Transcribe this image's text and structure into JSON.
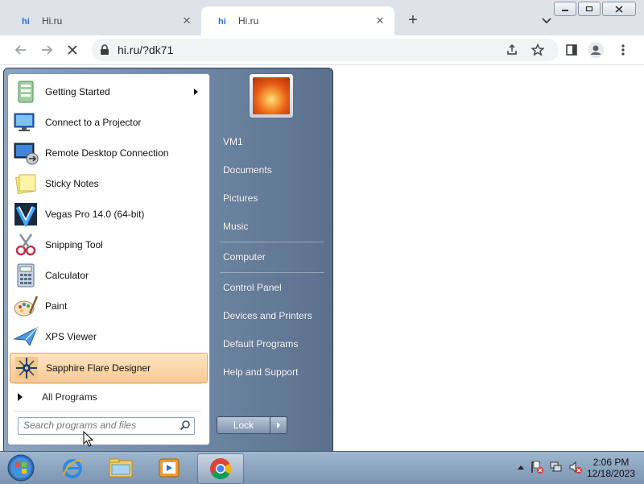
{
  "browser": {
    "tabs": [
      {
        "title": "Hi.ru",
        "active": false
      },
      {
        "title": "Hi.ru",
        "active": true
      }
    ],
    "url": "hi.ru/?dk71",
    "favicon_text": "hi"
  },
  "start_menu": {
    "programs": [
      {
        "label": "Getting Started",
        "icon": "getting-started-icon",
        "has_submenu": true
      },
      {
        "label": "Connect to a Projector",
        "icon": "projector-icon"
      },
      {
        "label": "Remote Desktop Connection",
        "icon": "remote-desktop-icon"
      },
      {
        "label": "Sticky Notes",
        "icon": "sticky-notes-icon"
      },
      {
        "label": "Vegas Pro 14.0 (64-bit)",
        "icon": "vegas-pro-icon"
      },
      {
        "label": "Snipping Tool",
        "icon": "snipping-tool-icon"
      },
      {
        "label": "Calculator",
        "icon": "calculator-icon"
      },
      {
        "label": "Paint",
        "icon": "paint-icon"
      },
      {
        "label": "XPS Viewer",
        "icon": "xps-viewer-icon"
      },
      {
        "label": "Sapphire Flare Designer",
        "icon": "sapphire-flare-icon",
        "highlighted": true
      }
    ],
    "all_programs": "All Programs",
    "search_placeholder": "Search programs and files",
    "right_links": [
      "VM1",
      "Documents",
      "Pictures",
      "Music",
      "Computer",
      "Control Panel",
      "Devices and Printers",
      "Default Programs",
      "Help and Support"
    ],
    "lock_label": "Lock"
  },
  "taskbar": {
    "pinned": [
      "internet-explorer-icon",
      "file-explorer-icon",
      "media-player-icon",
      "chrome-icon"
    ],
    "clock_time": "2:06 PM",
    "clock_date": "12/18/2023"
  },
  "colors": {
    "highlight": "#f9c995",
    "startmenu": "#6e86a3",
    "taskbar": "#8ea6c0"
  }
}
